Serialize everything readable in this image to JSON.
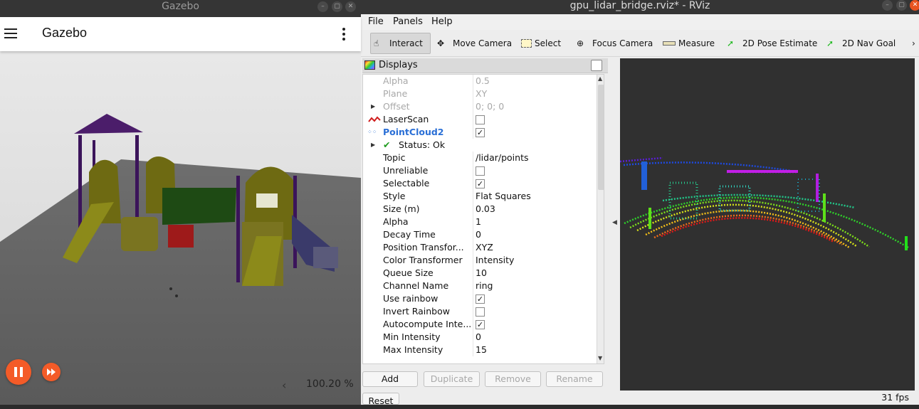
{
  "gazebo": {
    "window_title": "Gazebo",
    "app_title": "Gazebo",
    "real_time_factor": "100.20 %"
  },
  "rviz": {
    "window_title": "gpu_lidar_bridge.rviz* - RViz",
    "menu": [
      "File",
      "Panels",
      "Help"
    ],
    "toolbar": [
      "Interact",
      "Move Camera",
      "Select",
      "Focus Camera",
      "Measure",
      "2D Pose Estimate",
      "2D Nav Goal"
    ],
    "displays_title": "Displays",
    "rows": [
      {
        "name": "Alpha",
        "value": "0.5",
        "dim": true
      },
      {
        "name": "Plane",
        "value": "XY",
        "dim": true
      },
      {
        "name": "Offset",
        "value": "0; 0; 0",
        "dim": true
      },
      {
        "name": "LaserScan",
        "checked": false
      },
      {
        "name": "PointCloud2",
        "checked": true
      },
      {
        "name": "Status: Ok",
        "value": ""
      },
      {
        "name": "Topic",
        "value": "/lidar/points"
      },
      {
        "name": "Unreliable",
        "checked": false
      },
      {
        "name": "Selectable",
        "checked": true
      },
      {
        "name": "Style",
        "value": "Flat Squares"
      },
      {
        "name": "Size (m)",
        "value": "0.03"
      },
      {
        "name": "Alpha",
        "value": "1"
      },
      {
        "name": "Decay Time",
        "value": "0"
      },
      {
        "name": "Position Transfor...",
        "value": "XYZ"
      },
      {
        "name": "Color Transformer",
        "value": "Intensity"
      },
      {
        "name": "Queue Size",
        "value": "10"
      },
      {
        "name": "Channel Name",
        "value": "ring"
      },
      {
        "name": "Use rainbow",
        "checked": true
      },
      {
        "name": "Invert Rainbow",
        "checked": false
      },
      {
        "name": "Autocompute Inte...",
        "checked": true
      },
      {
        "name": "Min Intensity",
        "value": "0"
      },
      {
        "name": "Max Intensity",
        "value": "15"
      }
    ],
    "buttons": {
      "add": "Add",
      "duplicate": "Duplicate",
      "remove": "Remove",
      "rename": "Rename",
      "reset": "Reset"
    },
    "fps": "31 fps",
    "colors": {
      "pointcloud_label": "#2a6fd6",
      "status_ok": "#1e9b1e",
      "gazebo_accent": "#f45b28"
    }
  }
}
